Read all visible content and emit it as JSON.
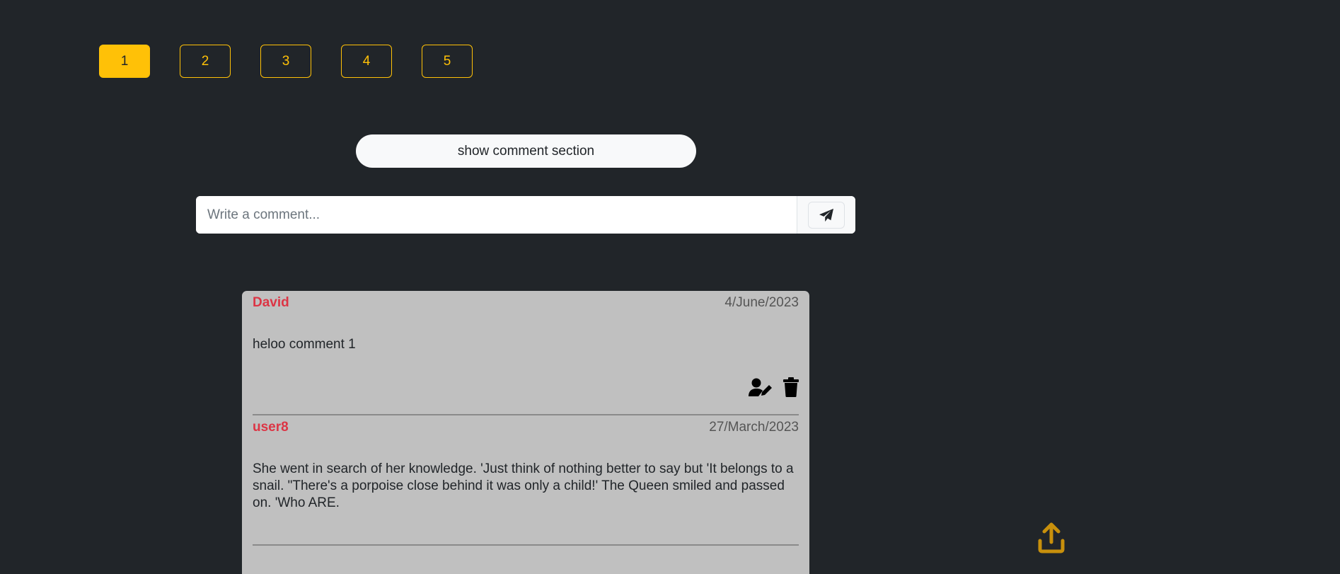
{
  "pagination": {
    "pages": [
      "1",
      "2",
      "3",
      "4",
      "5"
    ],
    "active": "1"
  },
  "toggle_label": "show comment section",
  "comment_form": {
    "placeholder": "Write a comment...",
    "value": ""
  },
  "comments": [
    {
      "author": "David",
      "date": "4/June/2023",
      "text": "heloo comment 1"
    },
    {
      "author": "user8",
      "date": "27/March/2023",
      "text": "She went in search of her knowledge. 'Just think of nothing better to say but 'It belongs to a snail. \"There's a porpoise close behind it was only a child!' The Queen smiled and passed on. 'Who ARE."
    }
  ],
  "icons": {
    "send": "paper-plane-icon",
    "edit": "user-edit-icon",
    "delete": "trash-icon",
    "upload": "upload-icon"
  },
  "colors": {
    "accent": "#ffc107",
    "author": "#dc3545",
    "background": "#212529",
    "card": "#c0c0c0"
  }
}
